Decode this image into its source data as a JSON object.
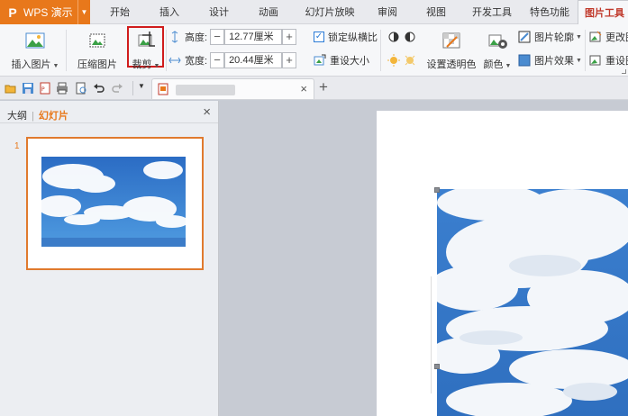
{
  "app": {
    "name": "WPS 演示"
  },
  "tabs": [
    {
      "label": "开始"
    },
    {
      "label": "插入"
    },
    {
      "label": "设计"
    },
    {
      "label": "动画"
    },
    {
      "label": "幻灯片放映"
    },
    {
      "label": "审阅"
    },
    {
      "label": "视图"
    },
    {
      "label": "开发工具"
    },
    {
      "label": "特色功能"
    },
    {
      "label": "图片工具"
    }
  ],
  "ribbon": {
    "insert_picture": "插入图片",
    "compress_picture": "压缩图片",
    "crop": "裁剪",
    "height_label": "高度:",
    "height_value": "12.77厘米",
    "width_label": "宽度:",
    "width_value": "20.44厘米",
    "lock_ratio": "锁定纵横比",
    "reset_size": "重设大小",
    "set_transparent": "设置透明色",
    "color": "颜色",
    "picture_outline": "图片轮廓",
    "picture_effects": "图片效果",
    "change_picture": "更改图",
    "reset_picture": "重设图",
    "minus": "−",
    "plus": "+",
    "check": "✓"
  },
  "panel": {
    "tab_outline": "大纲",
    "tab_divider": "|",
    "tab_slides": "幻灯片",
    "close": "×",
    "slide_number": "1"
  },
  "doc_tab": {
    "close": "×",
    "new_tab": "+"
  },
  "colors": {
    "accent": "#e8781b",
    "crop_highlight": "#d01c1c",
    "sky": "#2a6fc4"
  }
}
